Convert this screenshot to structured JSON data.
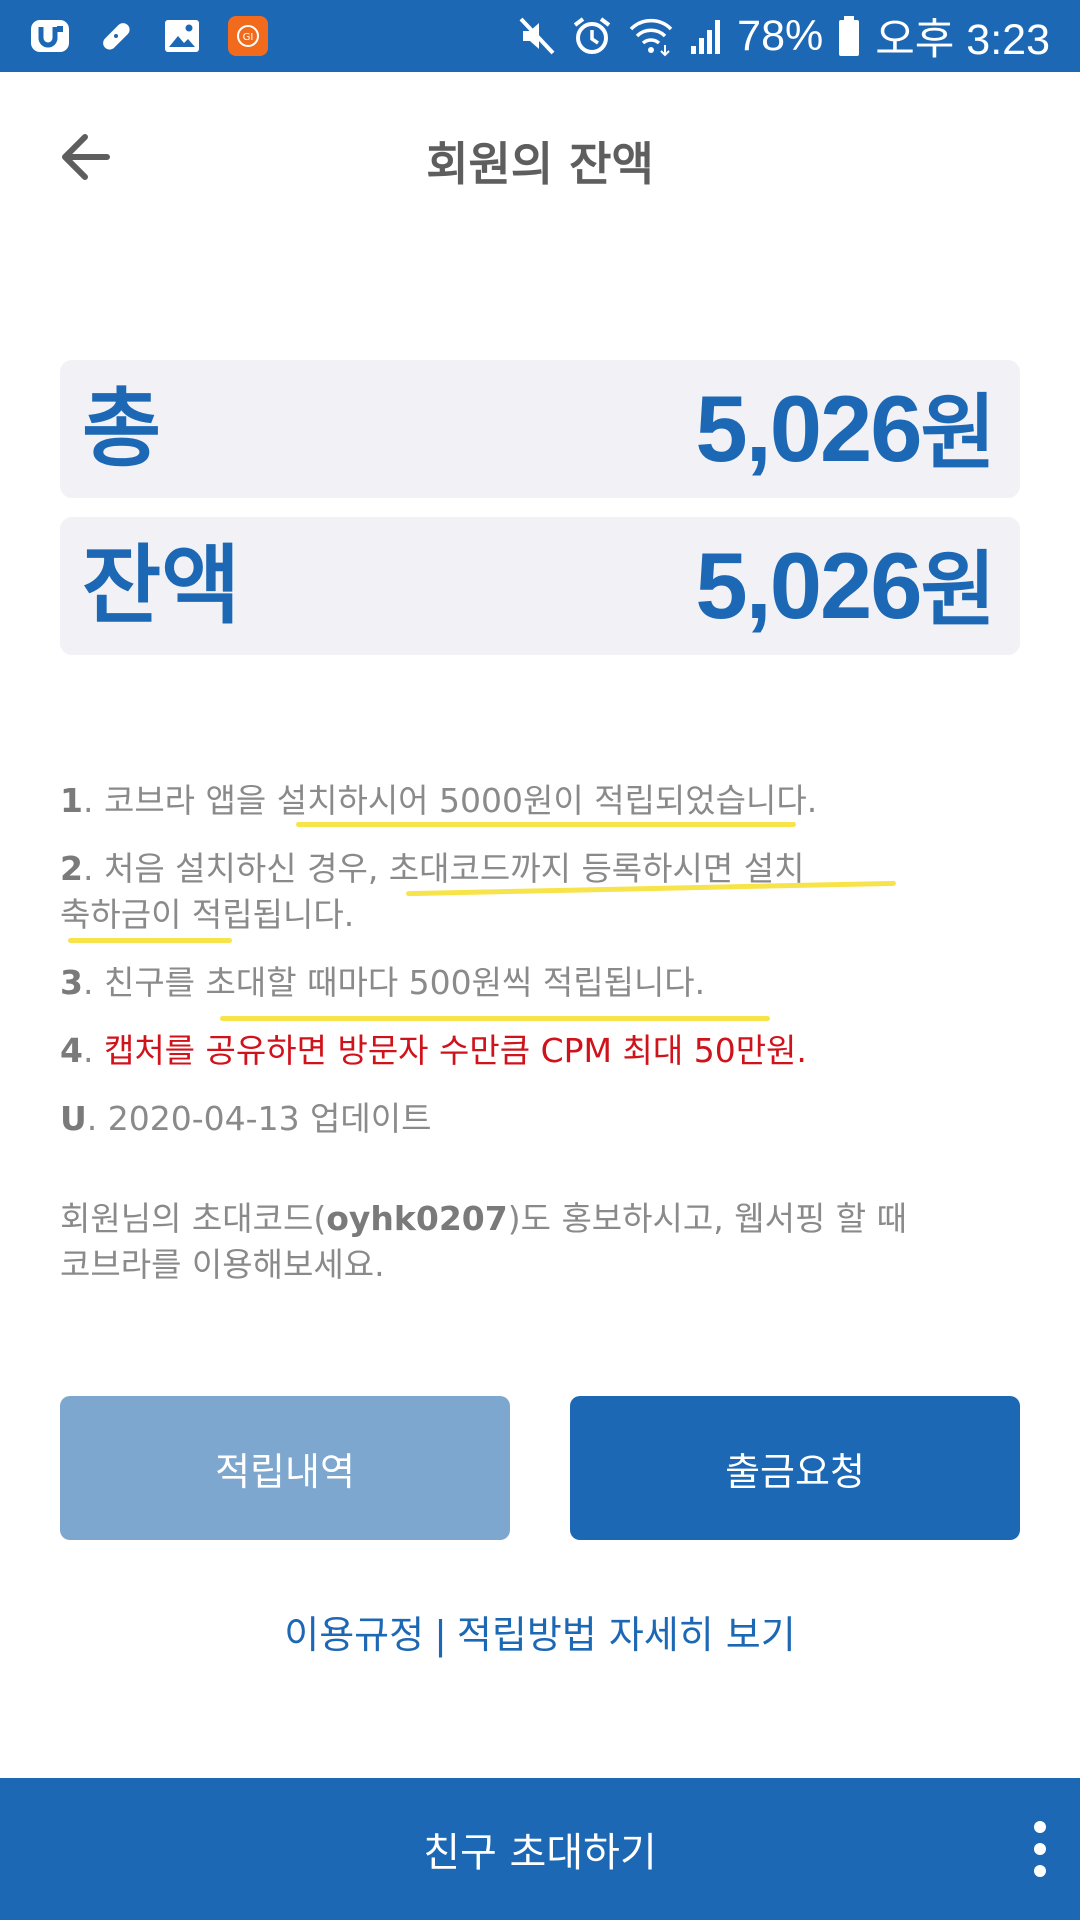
{
  "status_bar": {
    "battery": "78%",
    "time": "오후 3:23",
    "icons": [
      "u-app-icon",
      "bandage-icon",
      "gallery-icon",
      "orange-app-icon",
      "mute-icon",
      "alarm-icon",
      "wifi-icon",
      "signal-icon",
      "battery-icon"
    ]
  },
  "header": {
    "title": "회원의 잔액",
    "back_icon": "arrow-left-icon"
  },
  "balances": {
    "total_label": "총",
    "total_value": "5,026",
    "total_unit": "원",
    "remaining_label": "잔액",
    "remaining_value": "5,026",
    "remaining_unit": "원"
  },
  "notices": [
    {
      "num": "1",
      "text": "코브라 앱을 설치하시어 5000원이 적립되었습니다."
    },
    {
      "num": "2",
      "text_line1": "처음 설치하신 경우, 초대코드까지 등록하시면 설치",
      "text_line2": "축하금이 적립됩니다."
    },
    {
      "num": "3",
      "text": "친구를 초대할 때마다 500원씩 적립됩니다."
    },
    {
      "num": "4",
      "text": "캡처를 공유하면 방문자 수만큼 CPM 최대 50만원."
    },
    {
      "num": "U",
      "text": "2020-04-13 업데이트"
    }
  ],
  "invite": {
    "prefix": "회원님의 초대코드(",
    "code": "oyhk0207",
    "suffix_line1": ")도 홍보하시고, 웹서핑 할 때",
    "line2": "코브라를 이용해보세요."
  },
  "buttons": {
    "history": "적립내역",
    "withdraw": "출금요청"
  },
  "links": {
    "terms": "이용규정",
    "separator": "|",
    "details": "적립방법 자세히 보기"
  },
  "bottom_bar": {
    "invite_friend": "친구 초대하기",
    "more_icon": "more-vertical-icon"
  },
  "colors": {
    "brand_blue": "#1d68b4",
    "light_blue": "#7ea7cf",
    "red": "#d0121b",
    "highlight_yellow": "#f7e34a"
  }
}
